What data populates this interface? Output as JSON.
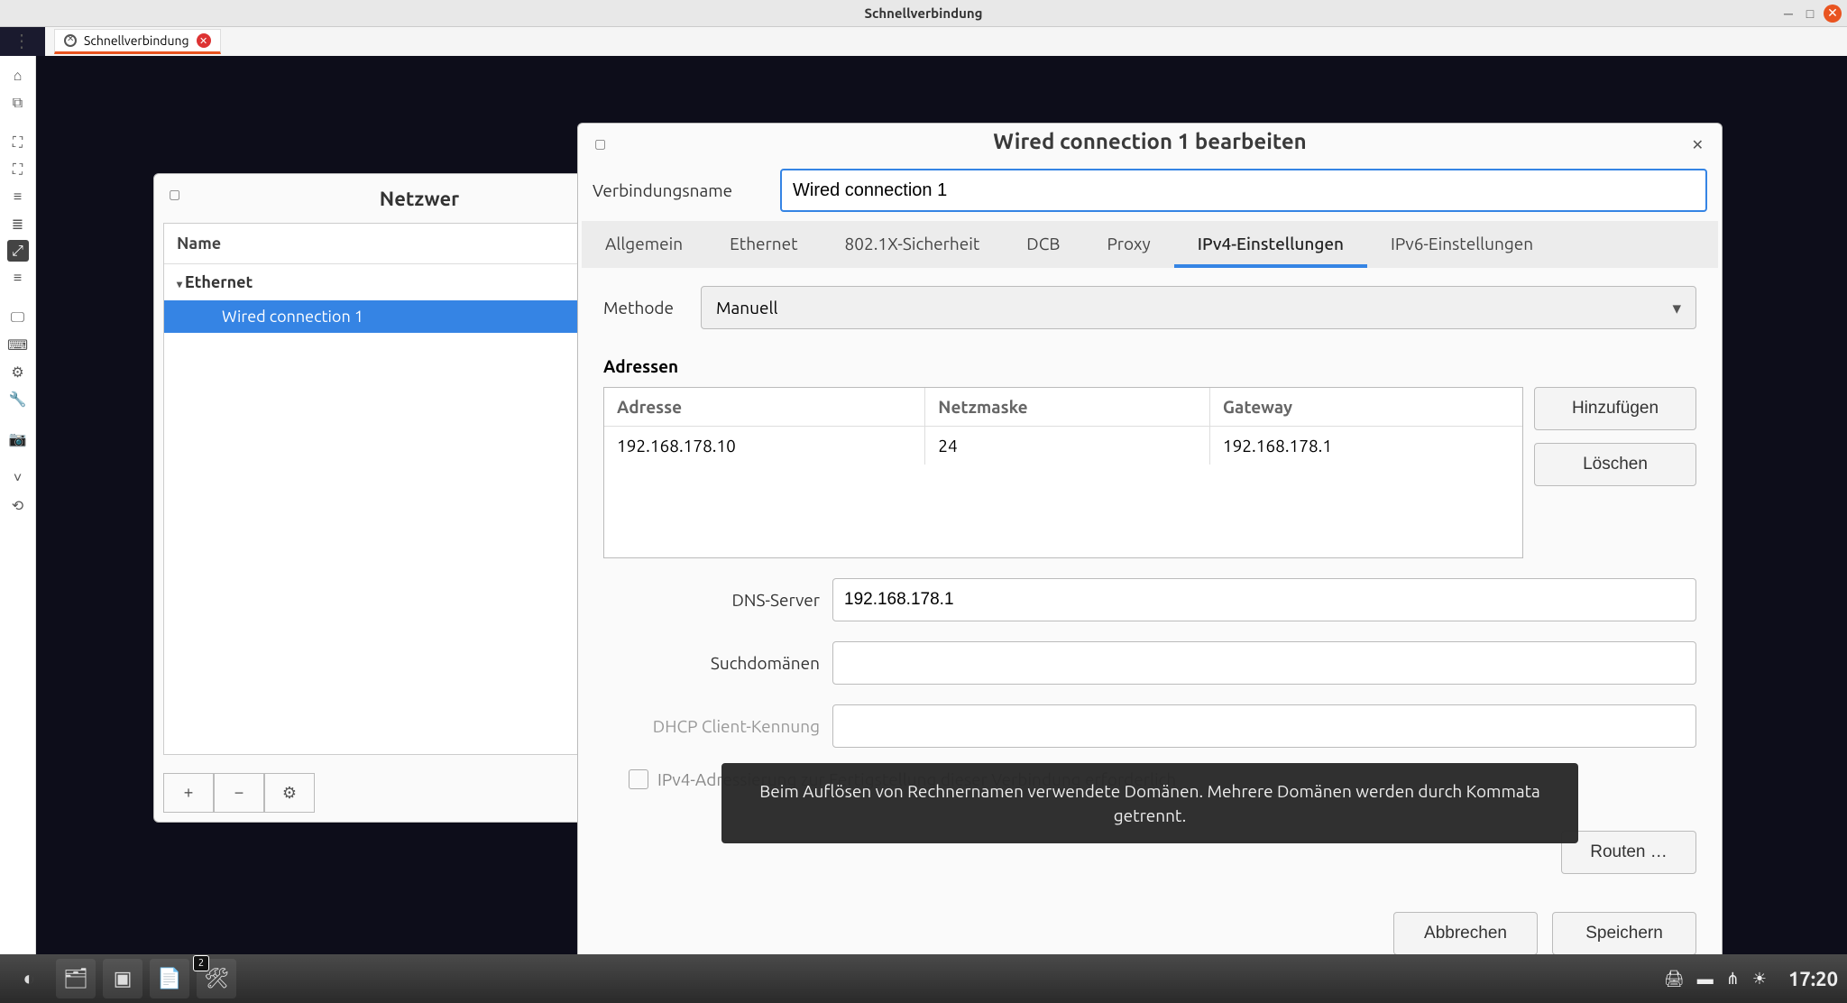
{
  "window": {
    "title": "Schnellverbindung"
  },
  "tabstrip": {
    "tab_label": "Schnellverbindung"
  },
  "netwin": {
    "title": "Netzwer",
    "col_name": "Name",
    "category": "Ethernet",
    "selected_connection": "Wired connection 1"
  },
  "editwin": {
    "title": "Wired connection 1 bearbeiten",
    "name_label": "Verbindungsname",
    "name_value": "Wired connection 1",
    "tabs": {
      "general": "Allgemein",
      "ethernet": "Ethernet",
      "security": "802.1X-Sicherheit",
      "dcb": "DCB",
      "proxy": "Proxy",
      "ipv4": "IPv4-Einstellungen",
      "ipv6": "IPv6-Einstellungen"
    },
    "method_label": "Methode",
    "method_value": "Manuell",
    "addresses_label": "Adressen",
    "addr_headers": {
      "addr": "Adresse",
      "mask": "Netzmaske",
      "gw": "Gateway"
    },
    "addr_row": {
      "addr": "192.168.178.10",
      "mask": "24",
      "gw": "192.168.178.1"
    },
    "btn_add": "Hinzufügen",
    "btn_del": "Löschen",
    "dns_label": "DNS-Server",
    "dns_value": "192.168.178.1",
    "domains_label": "Suchdomänen",
    "dhcp_label": "DHCP Client-Kennung",
    "chk_label": "IPv4-Adressierung zur Fertigstellung dieser Verbindung erforderlich",
    "routes_btn": "Routen …",
    "cancel_btn": "Abbrechen",
    "save_btn": "Speichern"
  },
  "tooltip": "Beim Auflösen von Rechnernamen verwendete Domänen. Mehrere Domänen werden durch Kommata getrennt.",
  "taskbar": {
    "time": "17:20"
  }
}
